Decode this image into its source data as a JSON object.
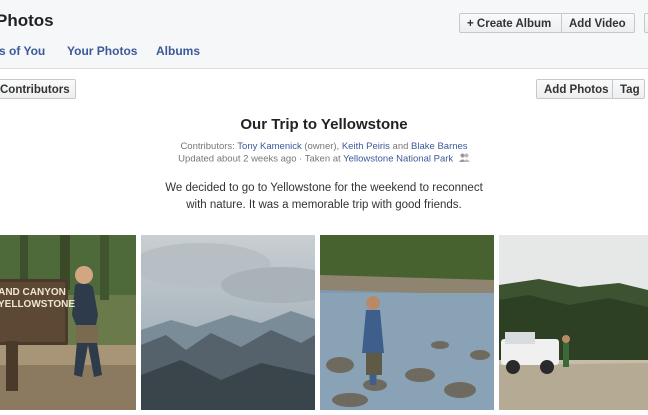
{
  "header": {
    "title": "Photos",
    "tabs": [
      {
        "label": "s of You"
      },
      {
        "label": "Your Photos"
      },
      {
        "label": "Albums"
      }
    ],
    "create_album_label": "+ Create Album",
    "add_video_label": "Add Video"
  },
  "toolbar": {
    "contributors_label": "Contributors",
    "add_photos_label": "Add Photos",
    "tag_label": "Tag"
  },
  "album": {
    "title": "Our Trip to Yellowstone",
    "contributors_prefix": "Contributors:",
    "contributor_1": "Tony Kamenick",
    "owner_note": "(owner),",
    "contributor_2": "Keith Peiris",
    "and_text": "and",
    "contributor_3": "Blake Barnes",
    "updated_text": "Updated about 2 weeks ago · Taken at",
    "location": "Yellowstone National Park",
    "description_line_1": "We decided to go to Yellowstone for the weekend to reconnect",
    "description_line_2": "with nature. It was a memorable trip with good friends."
  },
  "photos": [
    {
      "subject": "man at canyon sign",
      "sign_line_1": "AND CANYON",
      "sign_line_2": "YELLOWSTONE"
    },
    {
      "subject": "mountain range under cloudy sky"
    },
    {
      "subject": "man standing in rocky river"
    },
    {
      "subject": "jeep on dirt road near forest"
    }
  ],
  "icons": {
    "people": "people-icon"
  },
  "colors": {
    "link": "#3b5998",
    "header_bg": "#f6f7f9"
  }
}
